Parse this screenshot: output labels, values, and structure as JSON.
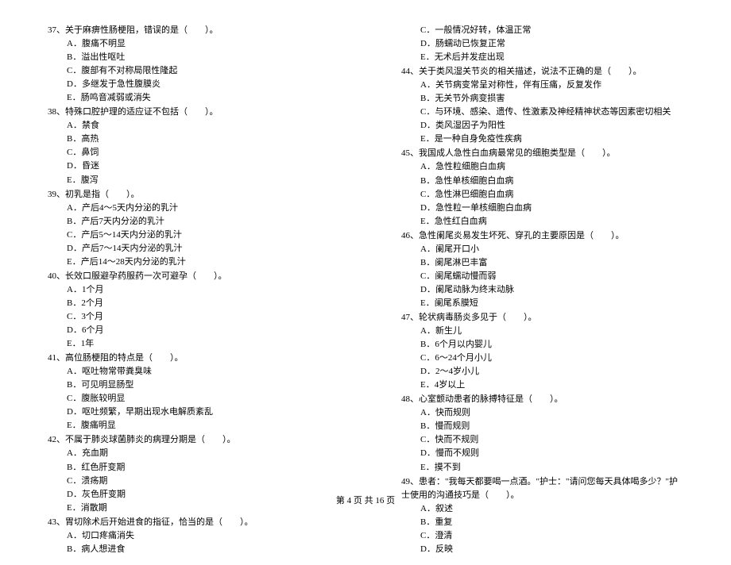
{
  "footer": "第 4 页 共 16 页",
  "left": [
    {
      "q": "37、关于麻痹性肠梗阻，错误的是（　　）。",
      "opts": [
        "A．腹痛不明显",
        "B．溢出性呕吐",
        "C．腹部有不对称局限性隆起",
        "D．多继发于急性腹膜炎",
        "E．肠鸣音减弱或消失"
      ]
    },
    {
      "q": "38、特殊口腔护理的适应证不包括（　　）。",
      "opts": [
        "A．禁食",
        "B．高热",
        "C．鼻饲",
        "D．昏迷",
        "E．腹泻"
      ]
    },
    {
      "q": "39、初乳是指（　　）。",
      "opts": [
        "A．产后4～5天内分泌的乳汁",
        "B．产后7天内分泌的乳汁",
        "C．产后5～14天内分泌的乳汁",
        "D．产后7～14天内分泌的乳汁",
        "E．产后14～28天内分泌的乳汁"
      ]
    },
    {
      "q": "40、长效口服避孕药服药一次可避孕（　　）。",
      "opts": [
        "A．1个月",
        "B．2个月",
        "C．3个月",
        "D．6个月",
        "E．1年"
      ]
    },
    {
      "q": "41、高位肠梗阻的特点是（　　）。",
      "opts": [
        "A．呕吐物常带粪臭味",
        "B．可见明显肠型",
        "C．腹胀较明显",
        "D．呕吐频繁，早期出现水电解质紊乱",
        "E．腹痛明显"
      ]
    },
    {
      "q": "42、不属于肺炎球菌肺炎的病理分期是（　　）。",
      "opts": [
        "A．充血期",
        "B．红色肝变期",
        "C．溃疡期",
        "D．灰色肝变期",
        "E．消散期"
      ]
    },
    {
      "q": "43、胃切除术后开始进食的指征，恰当的是（　　）。",
      "opts": [
        "A．切口疼痛消失",
        "B．病人想进食"
      ]
    }
  ],
  "right": [
    {
      "q": "",
      "opts": [
        "C．一般情况好转，体温正常",
        "D．肠蠕动已恢复正常",
        "E．无术后并发症出现"
      ]
    },
    {
      "q": "44、关于类风湿关节炎的相关描述，说法不正确的是（　　）。",
      "opts": [
        "A．关节病变常呈对称性，伴有压痛，反复发作",
        "B．无关节外病变损害",
        "C．与环境、感染、遗传、性激素及神经精神状态等因素密切相关",
        "D．类风湿因子为阳性",
        "E．是一种自身免疫性疾病"
      ]
    },
    {
      "q": "45、我国成人急性白血病最常见的细胞类型是（　　）。",
      "opts": [
        "A．急性粒细胞白血病",
        "B．急性单核细胞白血病",
        "C．急性淋巴细胞白血病",
        "D．急性粒一单核细胞白血病",
        "E．急性红白血病"
      ]
    },
    {
      "q": "46、急性阑尾炎易发生坏死、穿孔的主要原因是（　　）。",
      "opts": [
        "A．阑尾开口小",
        "B．阑尾淋巴丰富",
        "C．阑尾蠕动慢而弱",
        "D．阑尾动脉为终末动脉",
        "E．阑尾系膜短"
      ]
    },
    {
      "q": "47、轮状病毒肠炎多见于（　　）。",
      "opts": [
        "A．新生儿",
        "B．6个月以内婴儿",
        "C．6～24个月小儿",
        "D．2～4岁小儿",
        "E．4岁以上"
      ]
    },
    {
      "q": "48、心室颤动患者的脉搏特征是（　　）。",
      "opts": [
        "A．快而规则",
        "B．慢而规则",
        "C．快而不规则",
        "D．慢而不规则",
        "E．摸不到"
      ]
    },
    {
      "q": "49、患者：\"我每天都要喝一点酒。\"护士：\"请问您每天具体喝多少？\"护士使用的沟通技巧是（　　）。",
      "opts": [
        "A．叙述",
        "B．重复",
        "C．澄清",
        "D．反映"
      ]
    }
  ]
}
